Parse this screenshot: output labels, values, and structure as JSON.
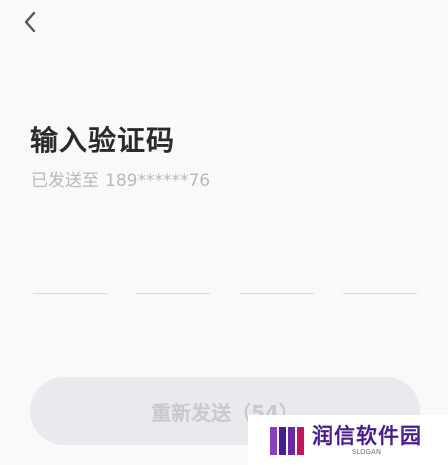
{
  "header": {
    "back_icon": "chevron-left-icon"
  },
  "main": {
    "title": "输入验证码",
    "sent_to_label": "已发送至",
    "phone_masked": "189******76",
    "code_inputs": [
      "",
      "",
      "",
      ""
    ],
    "resend_label": "重新发送（54）"
  },
  "watermark": {
    "name": "润信软件园",
    "slogan": "SLOGAN"
  },
  "colors": {
    "background": "#f9f9f9",
    "title": "#2b2b2b",
    "subtitle": "#b9b9b9",
    "button_bg": "#e9e9ee",
    "button_text": "#c9c9cc",
    "watermark_brand": "#4a1d8c"
  }
}
